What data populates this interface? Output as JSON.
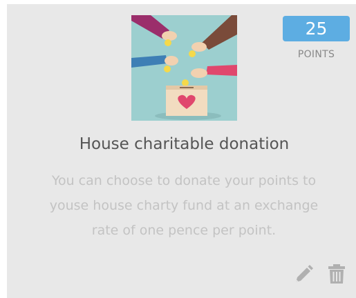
{
  "reward": {
    "title": "House charitable donation",
    "description": "You can choose to donate your points to youse house charty fund at an exchange rate of one pence per point.",
    "points": "25",
    "points_label": "POINTS",
    "image_icon": "donation-box-illustration"
  },
  "actions": {
    "edit_icon": "pencil-icon",
    "delete_icon": "trash-icon"
  },
  "colors": {
    "card_background": "#e8e8e8",
    "badge": "#5dade2",
    "title": "#555555",
    "description": "#c3c3c3",
    "icons": "#b0b0b0"
  }
}
